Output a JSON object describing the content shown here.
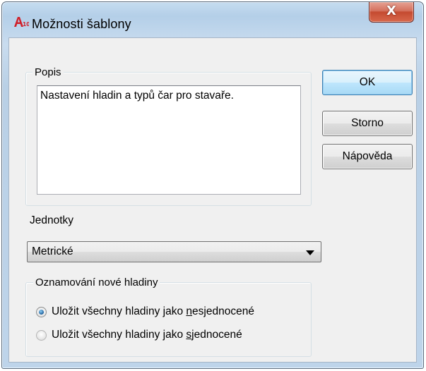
{
  "window": {
    "title": "Možnosti šablony",
    "close_glyph": "X"
  },
  "description": {
    "legend": "Popis",
    "text": "Nastavení hladin a typů čar pro stavaře."
  },
  "buttons": {
    "ok": "OK",
    "cancel": "Storno",
    "help": "Nápověda"
  },
  "units": {
    "label": "Jednotky",
    "selected": "Metrické"
  },
  "layer_notification": {
    "legend": "Oznamování nové hladiny",
    "options": [
      {
        "prefix": "Uložit všechny hladiny jako ",
        "mnemonic": "n",
        "suffix": "esjednocené",
        "checked": true
      },
      {
        "prefix": "Uložit všechny hladiny jako ",
        "mnemonic": "s",
        "suffix": "jednocené",
        "checked": false
      }
    ]
  },
  "colors": {
    "ok_border": "#3c7fb1",
    "close_button": "#c44a30",
    "radio_checked": "#1d5e9a"
  },
  "icons": {
    "app_icon": "autocad-a10-icon"
  }
}
